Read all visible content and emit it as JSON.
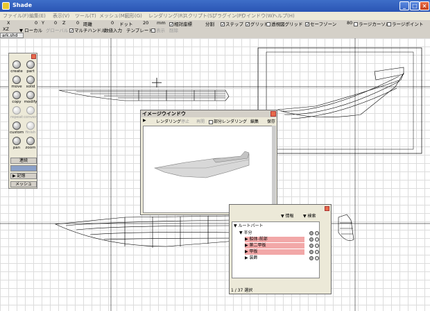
{
  "app": {
    "title": "Shade"
  },
  "menu": [
    "ファイル(F)",
    "編集(E)",
    "表示(V)",
    "ツール(T)",
    "メッシュ(M)",
    "図形(G)",
    "レンダリング(R)",
    "スクリプト(S)",
    "プラグイン(P)",
    "ウインドウ(W)",
    "ヘルプ(H)"
  ],
  "toolbar1": {
    "x_label": "X",
    "x_val": "0",
    "y_label": "Y",
    "y_val": "0",
    "z_label": "Z",
    "z_val": "0",
    "dist_label": "距離",
    "dist_val": "0",
    "dot_label": "ドット",
    "dot_val": "20",
    "unit": "mm",
    "relative": "相対座標",
    "split": "分割",
    "snap": "ステップ",
    "grid": "グリッド",
    "persp_grid": "透視図グリッド",
    "safezone": "セーフゾーン",
    "size": "80",
    "large_cursor": "ラージカーソル",
    "large_point": "ラージポイント"
  },
  "toolbar2": {
    "plane": "XZ",
    "local": "ローカル",
    "global": "グローバル",
    "multi_handle": "マルチハンドル",
    "numeric": "数値入力",
    "template": "テンプレート",
    "show": "表示",
    "delete": "削除"
  },
  "doc_tab": "ark.shd",
  "tool_palette": {
    "tools": [
      "create",
      "part",
      "move",
      "solid",
      "copy",
      "modify",
      "repeat",
      "convert",
      "custom",
      "finish",
      "pan",
      "zoom"
    ],
    "connect": "連続",
    "memory": "記憶",
    "mesh": "メッシュ"
  },
  "image_window": {
    "title": "イメージウインドウ",
    "render": "レンダリング",
    "stop": "停止",
    "replay": "再開",
    "partial": "部分レンダリング",
    "edit": "編集",
    "save": "保存"
  },
  "browser": {
    "info": "情報",
    "search": "検索",
    "root": "ルートパート",
    "items": [
      "半分",
      "船体-前部",
      "第二甲板",
      "甲板",
      "装飾"
    ],
    "status": "1 / 37 選択"
  },
  "colors": {
    "title_blue": "#2a55b4",
    "highlight": "#f2a8a8",
    "close": "#e86a4a"
  }
}
